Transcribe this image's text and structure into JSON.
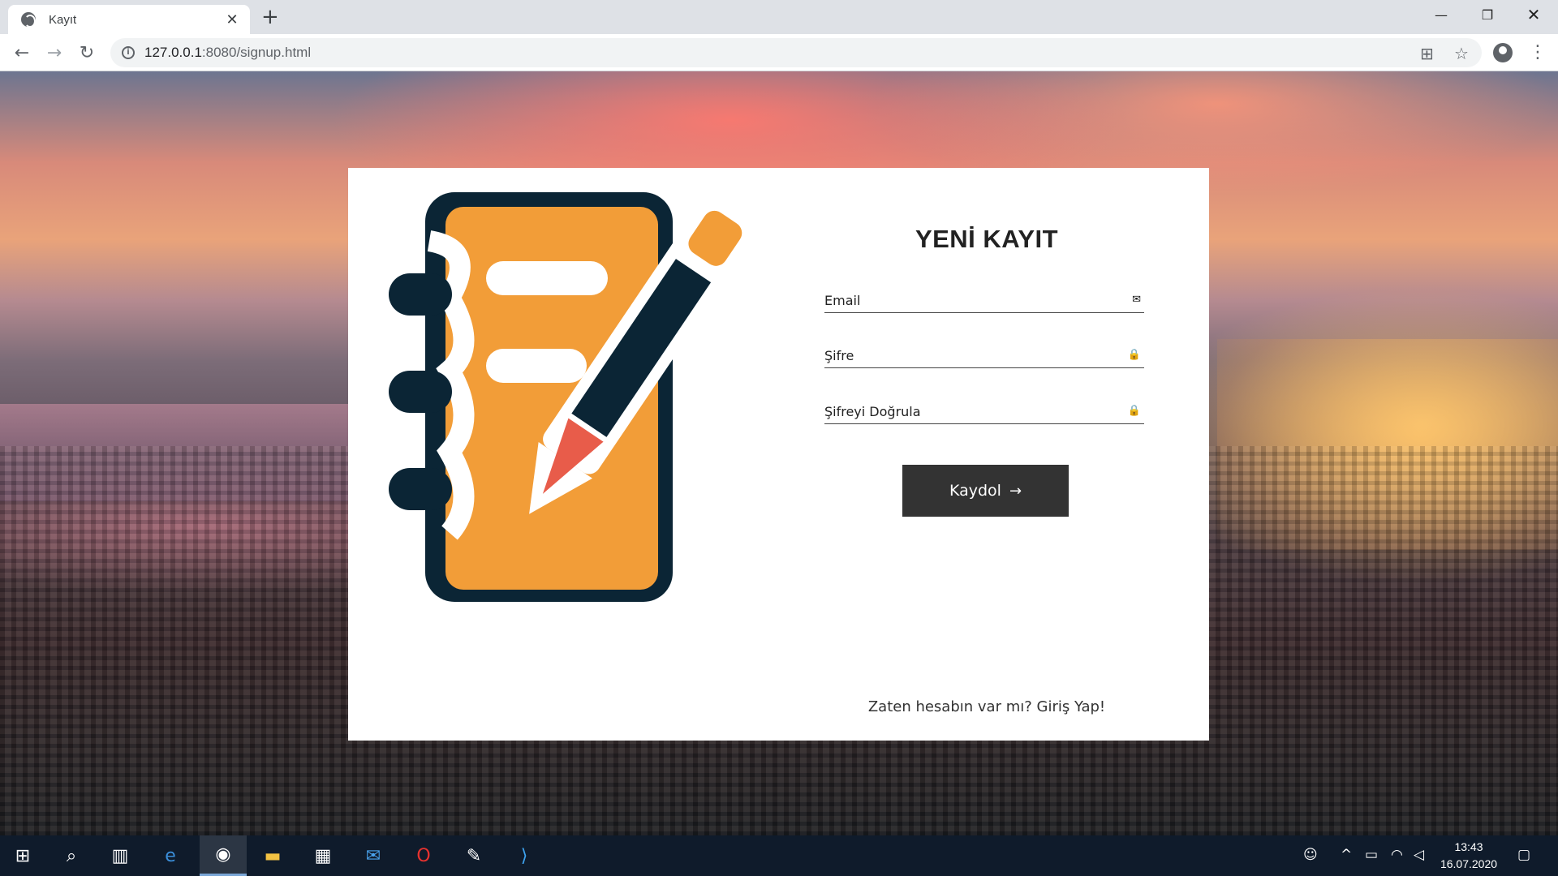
{
  "browser": {
    "tab_title": "Kayıt",
    "tab_close": "✕",
    "new_tab": "+",
    "url_host": "127.0.0.1",
    "url_rest": ":8080/signup.html",
    "window": {
      "minimize": "—",
      "maximize": "❐",
      "close": "✕"
    },
    "nav": {
      "back": "←",
      "forward": "→",
      "reload": "↻"
    },
    "icons": {
      "translate": "⊞",
      "star": "☆",
      "menu": "⋮"
    }
  },
  "signup": {
    "title": "YENİ KAYIT",
    "email_label": "Email",
    "password_label": "Şifre",
    "confirm_label": "Şifreyi Doğrula",
    "submit_label": "Kaydol",
    "submit_arrow": "→",
    "login_prompt": "Zaten hesabın var mı? Giriş Yap!",
    "email_icon": "envelope-icon",
    "lock_icon": "lock-icon"
  },
  "taskbar": {
    "time": "13:43",
    "date": "16.07.2020",
    "apps": [
      "windows-start",
      "search",
      "task-view",
      "edge",
      "chrome",
      "file-explorer",
      "store",
      "mail",
      "opera",
      "paint",
      "vscode"
    ]
  },
  "colors": {
    "notebook_orange": "#f29d38",
    "notebook_dark": "#0b2535",
    "pencil_tip": "#e85c4a",
    "button_bg": "#333333"
  }
}
